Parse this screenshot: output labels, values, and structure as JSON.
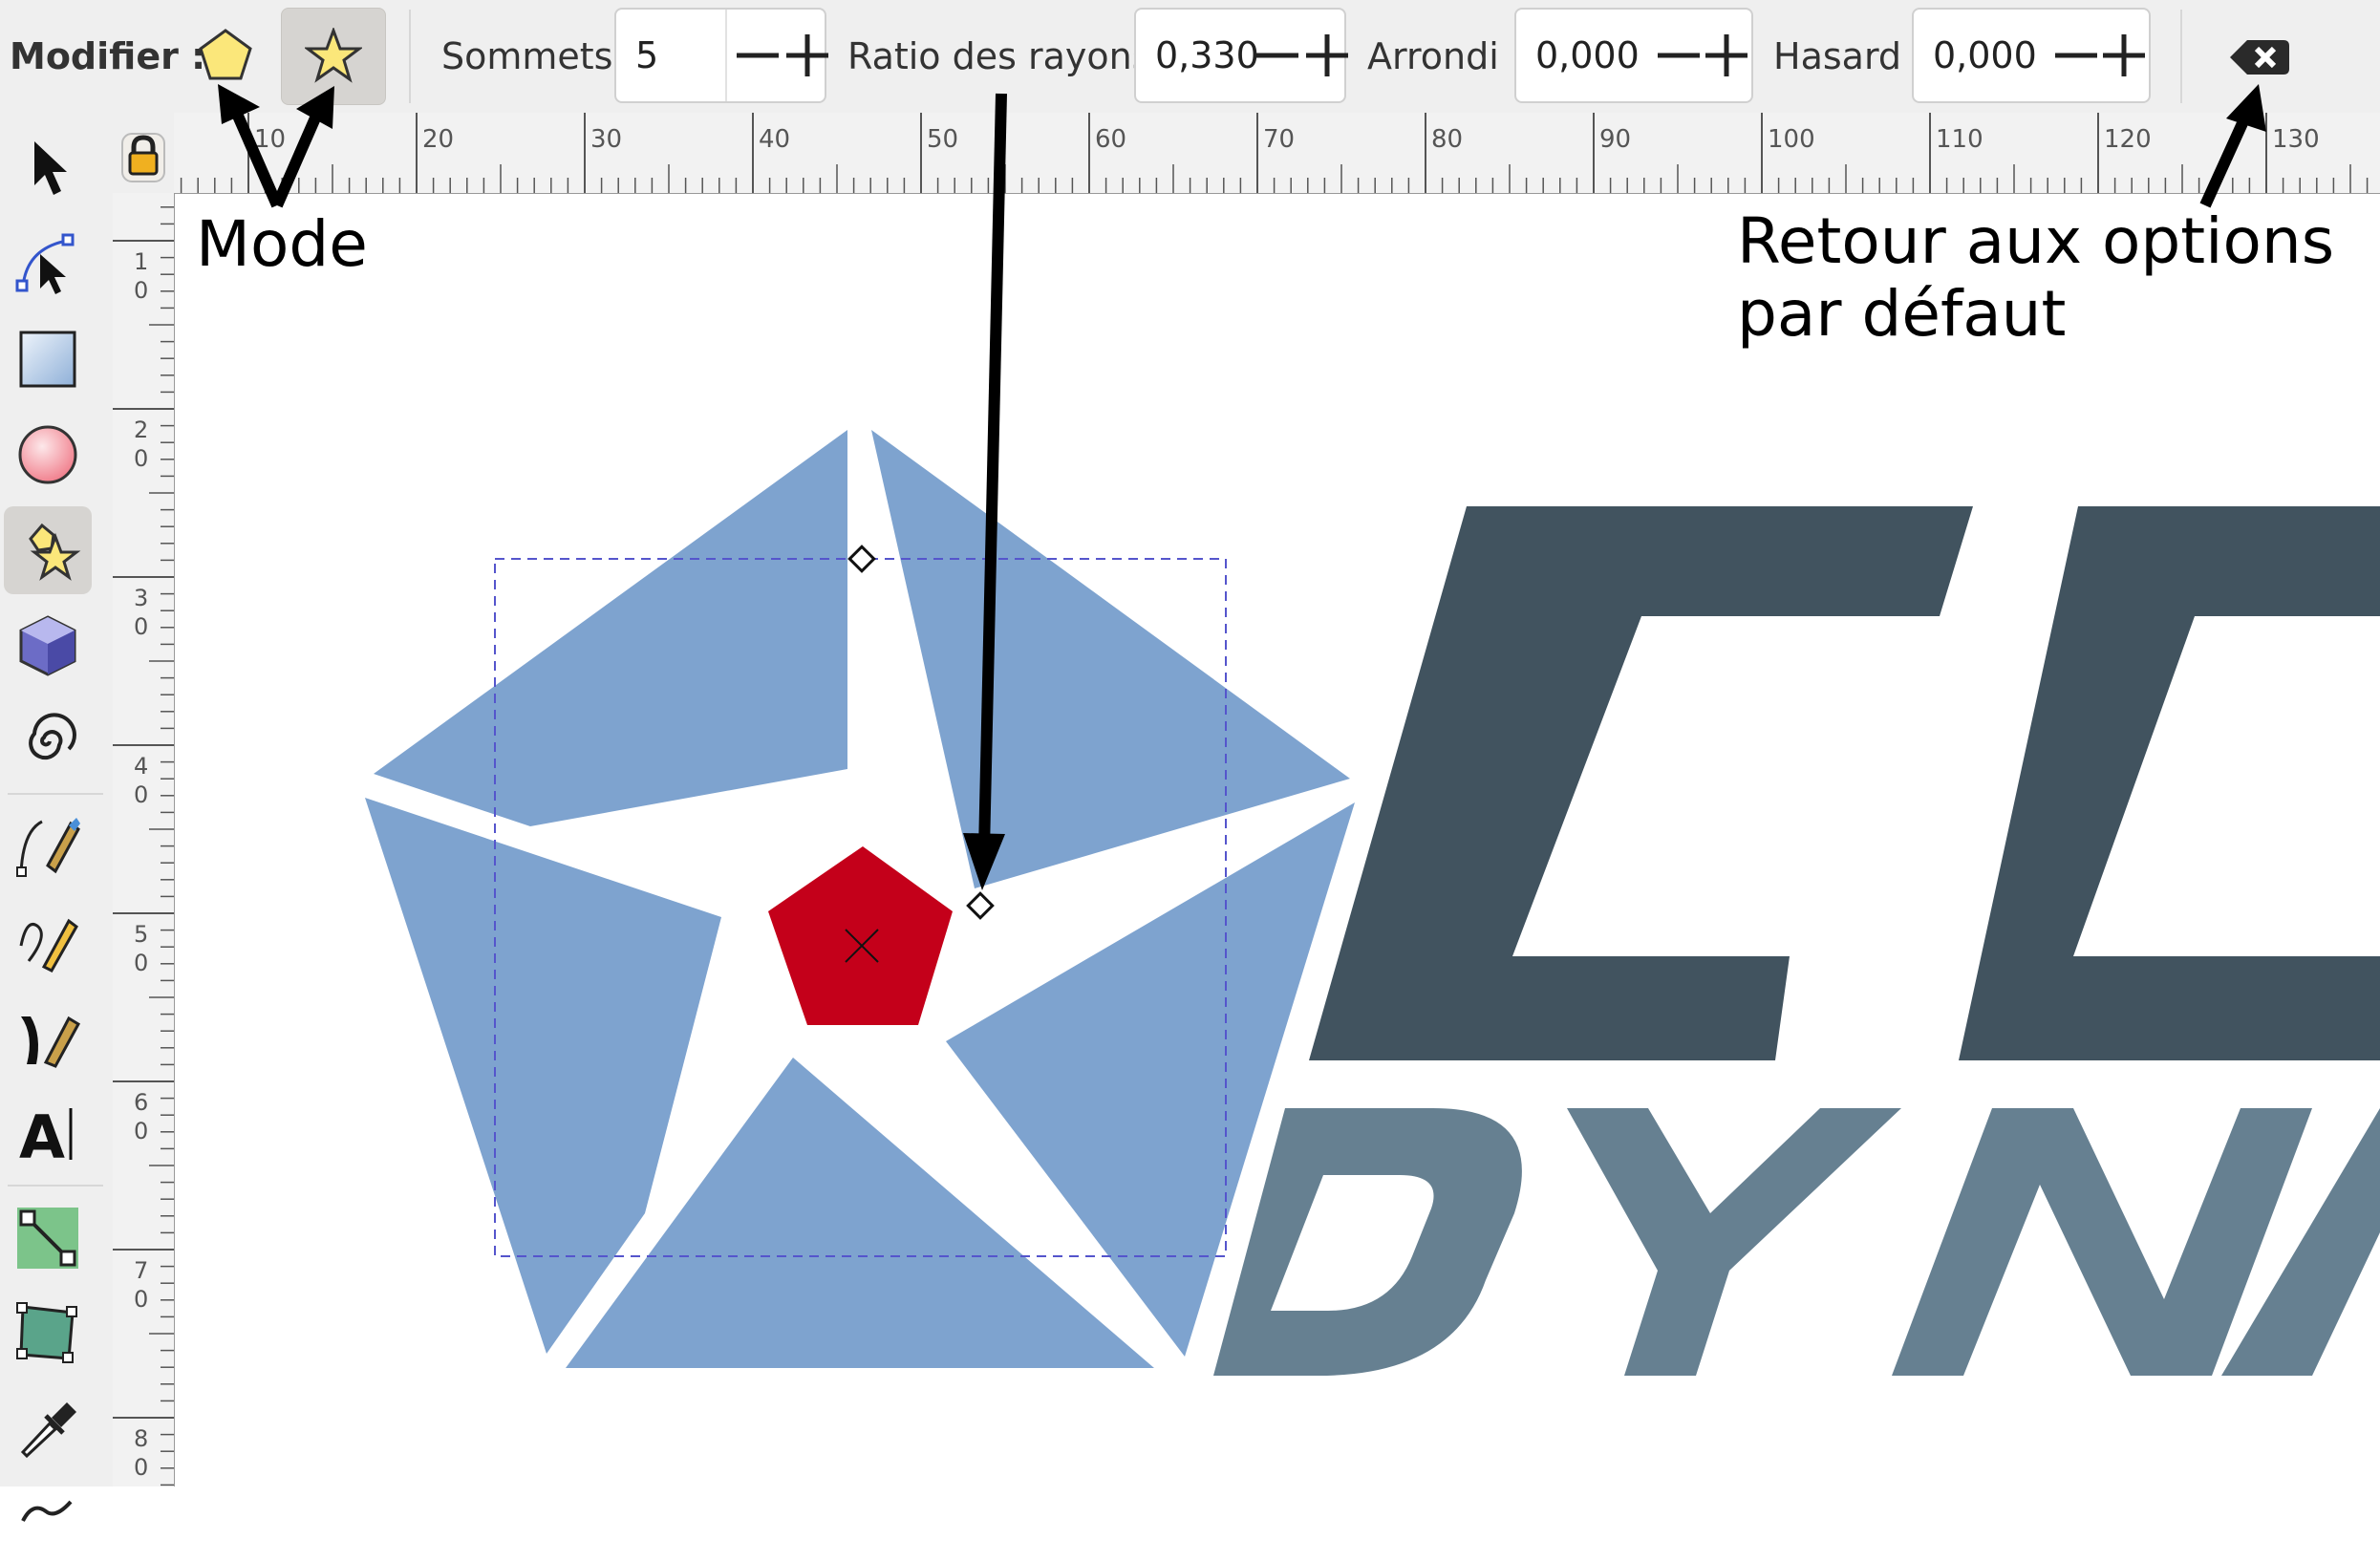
{
  "toolbar": {
    "modifier_label": "Modifier :",
    "modes": [
      {
        "name": "polygon-mode",
        "icon": "polygon-icon",
        "active": false
      },
      {
        "name": "star-mode",
        "icon": "star-icon",
        "active": true
      }
    ],
    "sommets": {
      "label": "Sommets :",
      "value": "5"
    },
    "ratio": {
      "label": "Ratio des rayons :",
      "value": "0,330"
    },
    "arrondi": {
      "label": "Arrondi :",
      "value": "0,000"
    },
    "hasard": {
      "label": "Hasard :",
      "value": "0,000"
    },
    "reset_icon": "clear-backspace-icon"
  },
  "rulers": {
    "horizontal_ticks": [
      "10",
      "20",
      "30",
      "40",
      "50",
      "60",
      "70",
      "80",
      "90",
      "100",
      "110",
      "120",
      "130"
    ],
    "vertical_ticks": [
      "1\n0",
      "2\n0",
      "3\n0",
      "4\n0",
      "5\n0",
      "6\n0",
      "7\n0",
      "8\n0"
    ]
  },
  "tools": [
    "selector-arrow-icon",
    "node-tool-icon",
    "rectangle-tool-icon",
    "ellipse-tool-icon",
    "star-polygon-tool-icon",
    "3d-box-tool-icon",
    "spiral-tool-icon",
    "pen-bezier-tool-icon",
    "pencil-tool-icon",
    "calligraphy-tool-icon",
    "text-tool-icon",
    "connector-tool-icon",
    "mesh-gradient-tool-icon",
    "dropper-tool-icon",
    "tweak-tool-icon"
  ],
  "annotations": {
    "mode": "Mode",
    "reset": "Retour aux options\npar défaut"
  },
  "logo": {
    "line1": "CO",
    "line2": "DYNA"
  },
  "colors": {
    "logo_blue": "#7ea3cf",
    "star_red": "#c4001a",
    "dark_slate": "#41535f",
    "slate_blue": "#668091",
    "selection_dash": "#5555cc"
  }
}
